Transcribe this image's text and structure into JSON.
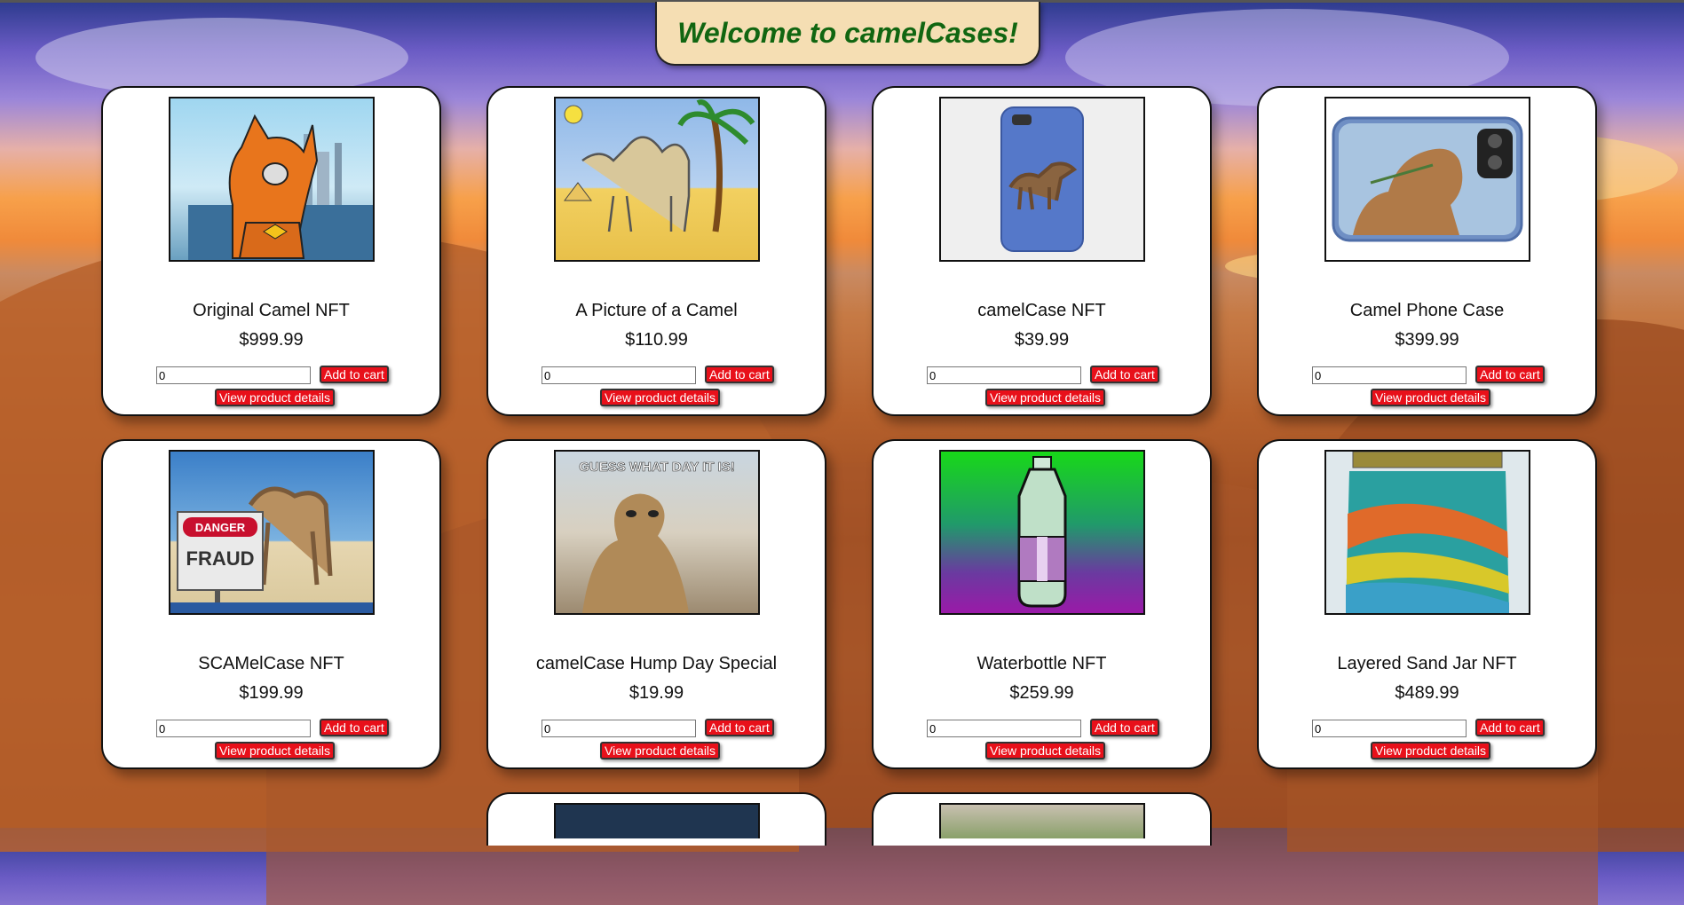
{
  "header": {
    "title": "Welcome to camelCases!"
  },
  "products": [
    {
      "name": "Original Camel NFT",
      "price": "$999.99",
      "qty": "0",
      "add_label": "Add to cart",
      "details_label": "View product details",
      "image": "cartoon-camel-nft"
    },
    {
      "name": "A Picture of a Camel",
      "price": "$110.99",
      "qty": "0",
      "add_label": "Add to cart",
      "details_label": "View product details",
      "image": "camel-drawing"
    },
    {
      "name": "camelCase NFT",
      "price": "$39.99",
      "qty": "0",
      "add_label": "Add to cart",
      "details_label": "View product details",
      "image": "blue-phone-case-camel"
    },
    {
      "name": "Camel Phone Case",
      "price": "$399.99",
      "qty": "0",
      "add_label": "Add to cart",
      "details_label": "View product details",
      "image": "camel-photo-phone-case"
    },
    {
      "name": "SCAMelCase NFT",
      "price": "$199.99",
      "qty": "0",
      "add_label": "Add to cart",
      "details_label": "View product details",
      "image": "danger-fraud-sign",
      "image_sign_top": "DANGER",
      "image_sign_bottom": "FRAUD"
    },
    {
      "name": "camelCase Hump Day Special",
      "price": "$19.99",
      "qty": "0",
      "add_label": "Add to cart",
      "details_label": "View product details",
      "image": "hump-day-camel",
      "image_caption": "GUESS WHAT DAY IT IS!"
    },
    {
      "name": "Waterbottle NFT",
      "price": "$259.99",
      "qty": "0",
      "add_label": "Add to cart",
      "details_label": "View product details",
      "image": "pixel-water-bottle"
    },
    {
      "name": "Layered Sand Jar NFT",
      "price": "$489.99",
      "qty": "0",
      "add_label": "Add to cart",
      "details_label": "View product details",
      "image": "sand-jar"
    }
  ],
  "partial_products": [
    {
      "image": "dark-blue-image"
    },
    {
      "image": "cactus-image"
    }
  ]
}
